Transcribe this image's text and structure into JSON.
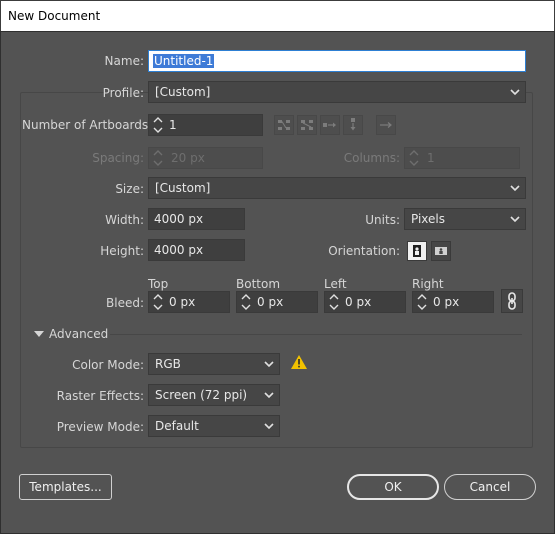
{
  "window": {
    "title": "New Document"
  },
  "name": {
    "label": "Name:",
    "value": "Untitled-1"
  },
  "profile": {
    "label": "Profile:",
    "value": "[Custom]"
  },
  "artboards": {
    "label": "Number of Artboards:",
    "value": "1"
  },
  "spacing": {
    "label": "Spacing:",
    "value": "20 px"
  },
  "columns": {
    "label": "Columns:",
    "value": "1"
  },
  "size": {
    "label": "Size:",
    "value": "[Custom]"
  },
  "width": {
    "label": "Width:",
    "value": "4000 px"
  },
  "units": {
    "label": "Units:",
    "value": "Pixels"
  },
  "height": {
    "label": "Height:",
    "value": "4000 px"
  },
  "orientation": {
    "label": "Orientation:"
  },
  "bleed": {
    "label": "Bleed:",
    "top": {
      "label": "Top",
      "value": "0 px"
    },
    "bottom": {
      "label": "Bottom",
      "value": "0 px"
    },
    "left": {
      "label": "Left",
      "value": "0 px"
    },
    "right": {
      "label": "Right",
      "value": "0 px"
    }
  },
  "advanced": {
    "label": "Advanced",
    "color_mode": {
      "label": "Color Mode:",
      "value": "RGB"
    },
    "raster_effects": {
      "label": "Raster Effects:",
      "value": "Screen (72 ppi)"
    },
    "preview_mode": {
      "label": "Preview Mode:",
      "value": "Default"
    }
  },
  "buttons": {
    "templates": "Templates...",
    "ok": "OK",
    "cancel": "Cancel"
  },
  "colors": {
    "accent": "#3e7bd7",
    "warning": "#f2c200",
    "background": "#535353"
  },
  "icons": [
    "spinner-icon",
    "chevron-down-icon",
    "grid-by-row-icon",
    "grid-by-column-icon",
    "arrange-by-row-icon",
    "arrange-by-column-icon",
    "right-to-left-icon",
    "portrait-icon",
    "landscape-icon",
    "link-icon",
    "warning-icon",
    "triangle-down-icon"
  ]
}
